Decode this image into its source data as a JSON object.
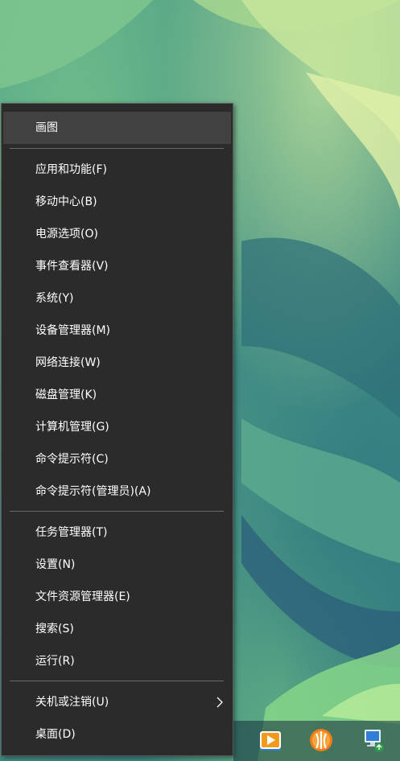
{
  "menu": {
    "items": [
      {
        "label": "画图"
      },
      {
        "label": "应用和功能(F)"
      },
      {
        "label": "移动中心(B)"
      },
      {
        "label": "电源选项(O)"
      },
      {
        "label": "事件查看器(V)"
      },
      {
        "label": "系统(Y)"
      },
      {
        "label": "设备管理器(M)"
      },
      {
        "label": "网络连接(W)"
      },
      {
        "label": "磁盘管理(K)"
      },
      {
        "label": "计算机管理(G)"
      },
      {
        "label": "命令提示符(C)"
      },
      {
        "label": "命令提示符(管理员)(A)"
      },
      {
        "label": "任务管理器(T)"
      },
      {
        "label": "设置(N)"
      },
      {
        "label": "文件资源管理器(E)"
      },
      {
        "label": "搜索(S)"
      },
      {
        "label": "运行(R)"
      },
      {
        "label": "关机或注销(U)"
      },
      {
        "label": "桌面(D)"
      }
    ]
  },
  "taskbar": {
    "icons": [
      "media-player-icon",
      "torrent-client-icon",
      "network-computer-icon"
    ]
  },
  "colors": {
    "menu_background": "#2b2b2b",
    "menu_hover": "#414141",
    "menu_text": "#ffffff",
    "separator": "#6a6a6a"
  }
}
